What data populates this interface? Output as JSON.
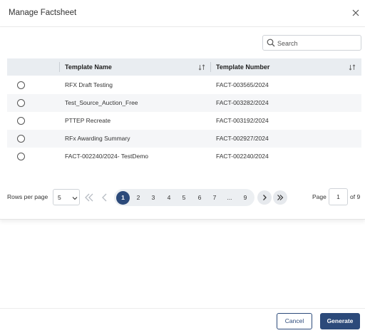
{
  "dialog": {
    "title": "Manage Factsheet"
  },
  "search": {
    "placeholder": "Search",
    "value": ""
  },
  "table": {
    "columns": [
      "Template Name",
      "Template Number"
    ],
    "rows": [
      {
        "name": "RFX Draft Testing",
        "number": "FACT-003565/2024"
      },
      {
        "name": "Test_Source_Auction_Free",
        "number": "FACT-003282/2024"
      },
      {
        "name": "PTTEP Recreate",
        "number": "FACT-003192/2024"
      },
      {
        "name": "RFx Awarding Summary",
        "number": "FACT-002927/2024"
      },
      {
        "name": "FACT-002240/2024- TestDemo",
        "number": "FACT-002240/2024"
      }
    ]
  },
  "pagination": {
    "rows_per_page_label": "Rows per page",
    "rows_per_page_value": "5",
    "pages": [
      "1",
      "2",
      "3",
      "4",
      "5",
      "6",
      "7",
      "...",
      "9"
    ],
    "current_page": "1",
    "page_label": "Page",
    "page_input": "1",
    "of_label": "of 9"
  },
  "footer": {
    "cancel_label": "Cancel",
    "generate_label": "Generate"
  },
  "colors": {
    "primary": "#2c4a7a",
    "header_bg": "#e9edf1",
    "row_alt_bg": "#f5f6f8"
  }
}
